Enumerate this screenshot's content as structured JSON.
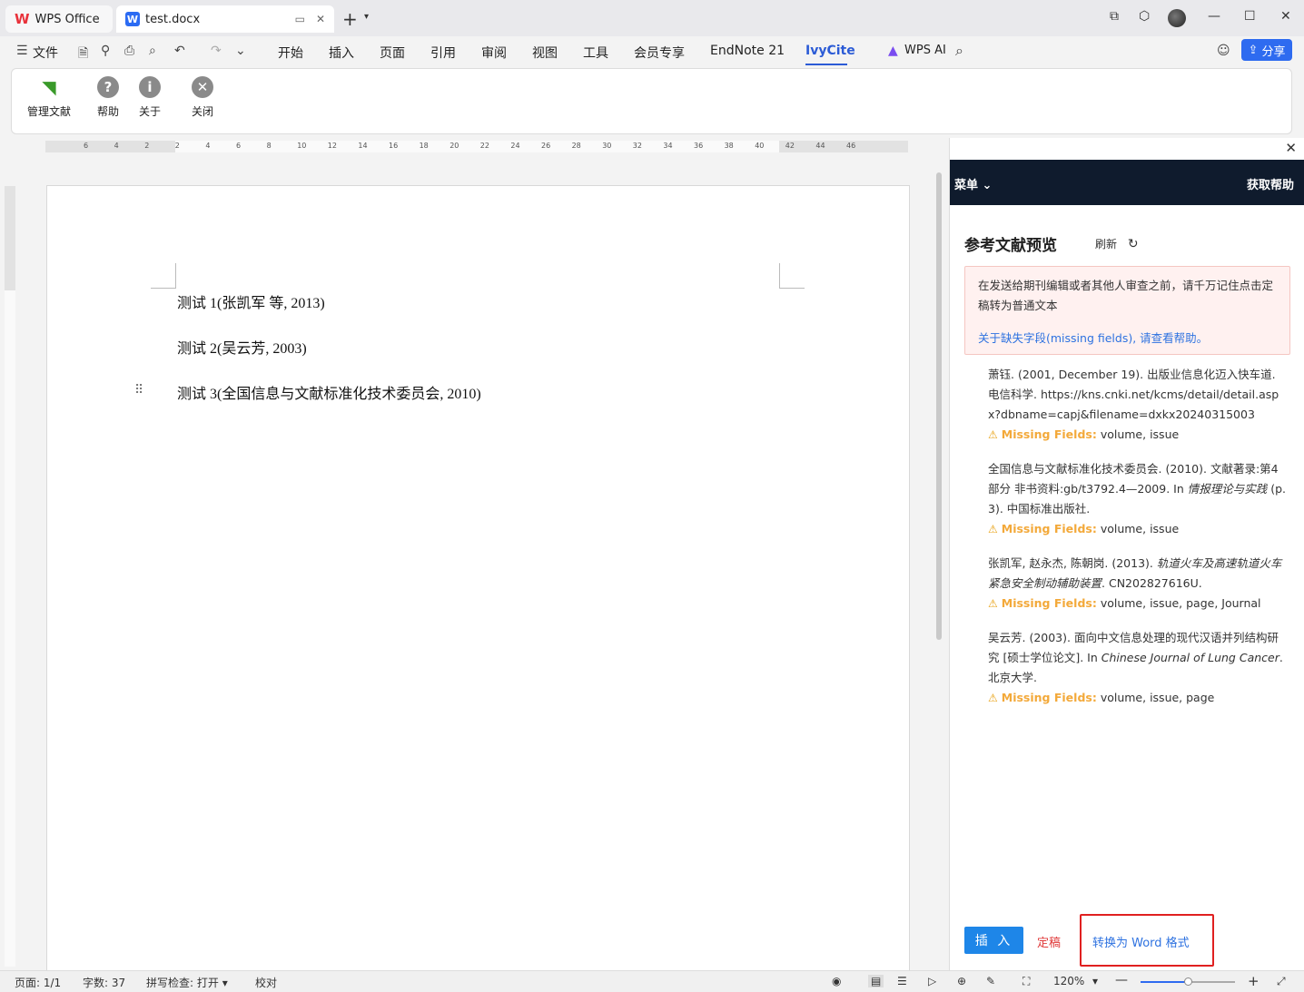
{
  "titlebar": {
    "tab_wps": "WPS Office",
    "tab_doc": "test.docx"
  },
  "menubar": {
    "file": "文件",
    "items": [
      "开始",
      "插入",
      "页面",
      "引用",
      "审阅",
      "视图",
      "工具",
      "会员专享",
      "EndNote 21",
      "IvyCite"
    ],
    "wps_ai": "WPS AI",
    "share": "分享"
  },
  "ribbon": {
    "manage": "管理文献",
    "help": "帮助",
    "about": "关于",
    "close": "关闭"
  },
  "ruler": {
    "h_ticks": [
      "6",
      "4",
      "2",
      "2",
      "4",
      "6",
      "8",
      "10",
      "12",
      "14",
      "16",
      "18",
      "20",
      "22",
      "24",
      "26",
      "28",
      "30",
      "32",
      "34",
      "36",
      "38",
      "40",
      "42",
      "44",
      "46"
    ]
  },
  "document": {
    "lines": [
      "测试 1(张凯军  等, 2013)",
      "测试 2(吴云芳, 2003)",
      "测试 3(全国信息与文献标准化技术委员会, 2010)"
    ]
  },
  "pane": {
    "menu": "菜单",
    "get_help": "获取帮助",
    "title": "参考文献预览",
    "refresh": "刷新",
    "alert_text": "在发送给期刊编辑或者其他人审查之前，请千万记住点击定稿转为普通文本",
    "alert_link": "关于缺失字段(missing fields), 请查看帮助。",
    "missing_label": "Missing Fields:",
    "refs": [
      {
        "text": "萧钰. (2001, December 19). 出版业信息化迈入快车道. 电信科学. https://kns.cnki.net/kcms/detail/detail.aspx?dbname=capj&filename=dxkx20240315003",
        "missing": "volume, issue"
      },
      {
        "pre": "全国信息与文献标准化技术委员会. (2010). 文献著录:第4部分 非书资料:gb/t3792.4—2009. In ",
        "ital": "情报理论与实践",
        "post": " (p. 3). 中国标准出版社.",
        "missing": "volume, issue"
      },
      {
        "pre": "张凯军, 赵永杰, 陈朝岗. (2013). ",
        "ital": "轨道火车及高速轨道火车紧急安全制动辅助装置",
        "post": ". CN202827616U.",
        "missing": "volume, issue, page, Journal"
      },
      {
        "pre": "吴云芳. (2003). 面向中文信息处理的现代汉语并列结构研究 [硕士学位论文]. In ",
        "ital": "Chinese Journal of Lung Cancer",
        "post": ". 北京大学.",
        "missing": "volume, issue, page"
      }
    ],
    "insert": "插 入",
    "finalize": "定稿",
    "convert": "转换为 Word 格式"
  },
  "statusbar": {
    "page": "页面: 1/1",
    "words": "字数: 37",
    "spell": "拼写检查: 打开",
    "proof": "校对",
    "zoom": "120%"
  }
}
